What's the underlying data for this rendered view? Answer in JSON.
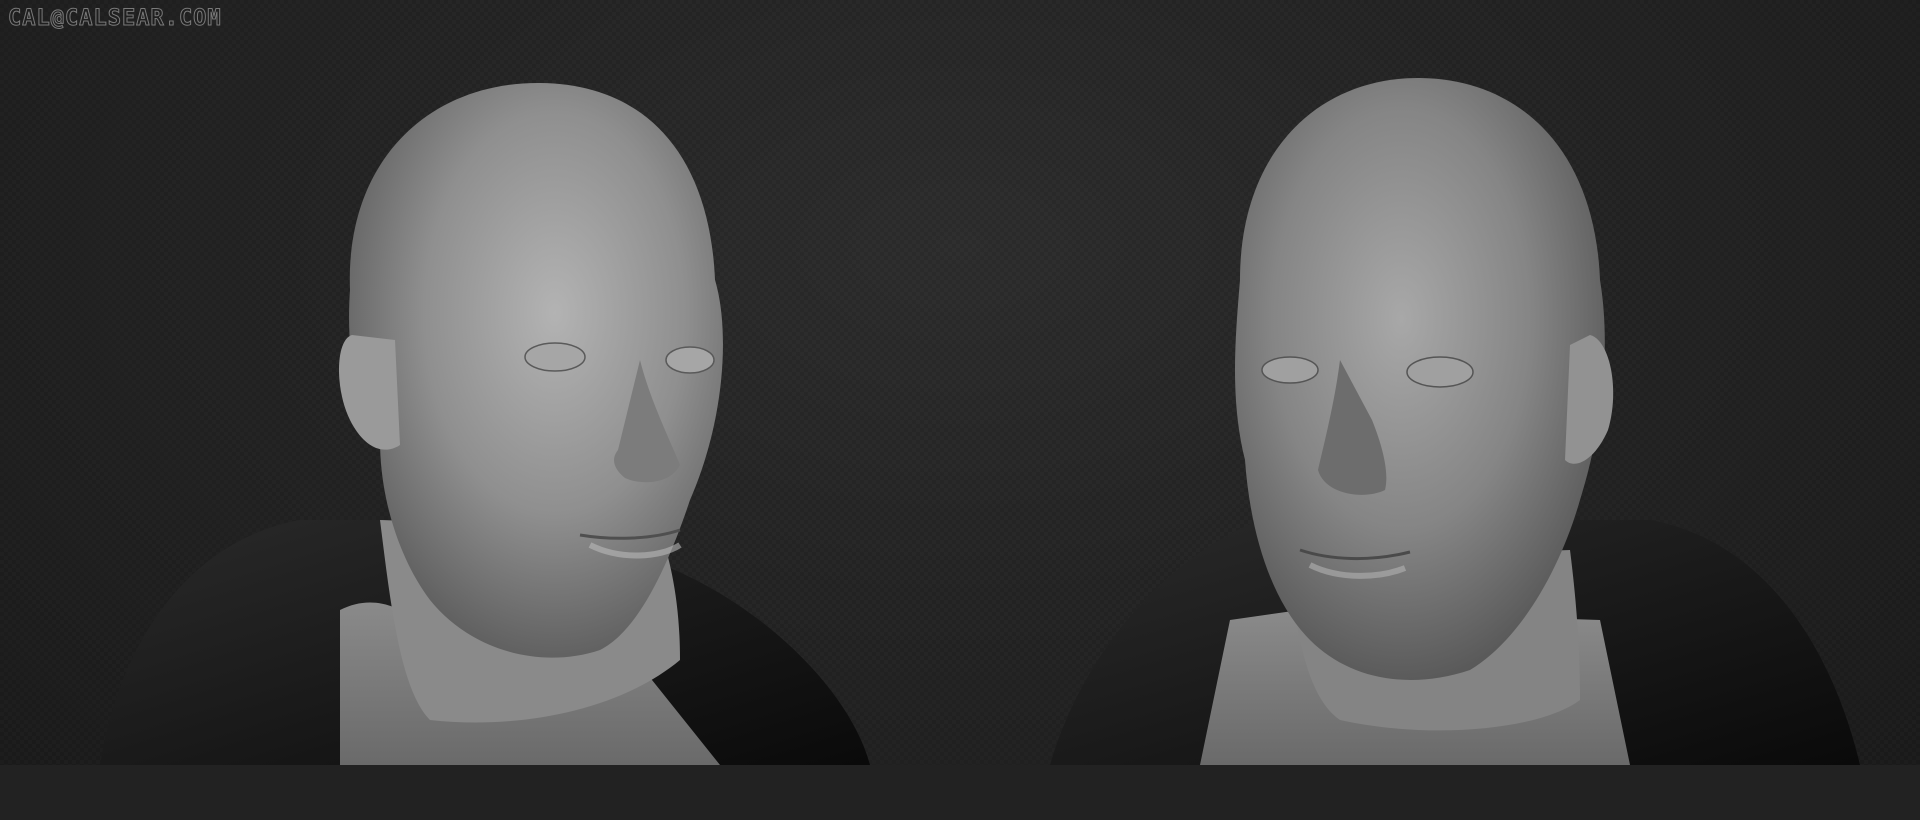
{
  "watermark": {
    "text": "CAL@CALSEAR.COM"
  },
  "render": {
    "subject_left": "bald-male-head-sculpt-three-quarter-view",
    "subject_right": "bald-male-head-sculpt-front-three-quarter-view",
    "colors": {
      "background": "#262626",
      "skin": "#8f8f8f",
      "jacket": "#111111",
      "shirt": "#7d7d7d"
    }
  }
}
